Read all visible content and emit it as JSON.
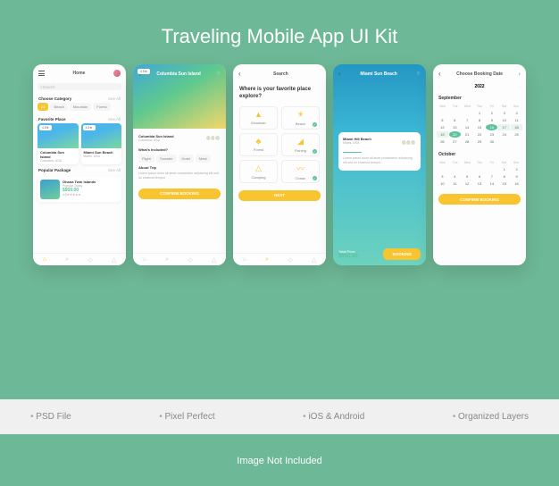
{
  "title": "Traveling Mobile App UI Kit",
  "features": [
    "PSD File",
    "Pixel Perfect",
    "iOS & Android",
    "Organized Layers"
  ],
  "disclaimer": "Image Not Included",
  "screen1": {
    "header": "Home",
    "search_placeholder": "Search",
    "category_label": "Choose Category",
    "see_all": "See All",
    "categories": [
      "All",
      "Beach",
      "Mountain",
      "Forest"
    ],
    "favorite_label": "Favorite Place",
    "cards": [
      {
        "badge": "4.5★",
        "title": "Columbia Sun Island",
        "sub": "Columbia, USA"
      },
      {
        "badge": "4.5★",
        "title": "Miami Sun Beach",
        "sub": "Miami, USA"
      }
    ],
    "popular_label": "Popular Package",
    "package": {
      "title": "Ghana Twin Islands",
      "sub": "Popular Today",
      "price": "$950.00",
      "rating": "4.5★★★★★"
    }
  },
  "screen2": {
    "header": "Columbia Sun Island",
    "hero_badge": "4.5★",
    "title": "Columbia Sun Island",
    "sub": "Columbia, USA",
    "included_label": "What's Included?",
    "included": [
      "Flight",
      "Transfer",
      "Hotel",
      "Meal"
    ],
    "about_label": "About Trip",
    "button": "CONFIRM BOOKING"
  },
  "screen3": {
    "header": "Search",
    "question": "Where is your favorite place explore?",
    "tiles": [
      "Mountain",
      "Beach",
      "Forest",
      "Fishing",
      "Camping",
      "Ocean"
    ],
    "button": "NEXT"
  },
  "screen4": {
    "header": "Miami Sun Beach",
    "card_title": "Miami Hill Beach",
    "card_sub": "Miami, USA",
    "total_label": "Total Price",
    "price": "$950.00",
    "button": "BOOKING"
  },
  "screen5": {
    "header": "Choose Booking Date",
    "year": "2022",
    "month1": "September",
    "month2": "October",
    "dow": [
      "Mon",
      "Tue",
      "Wed",
      "Thu",
      "Fri",
      "Sat",
      "Sun"
    ],
    "selected": [
      16,
      20
    ],
    "button": "CONFIRM BOOKING"
  }
}
